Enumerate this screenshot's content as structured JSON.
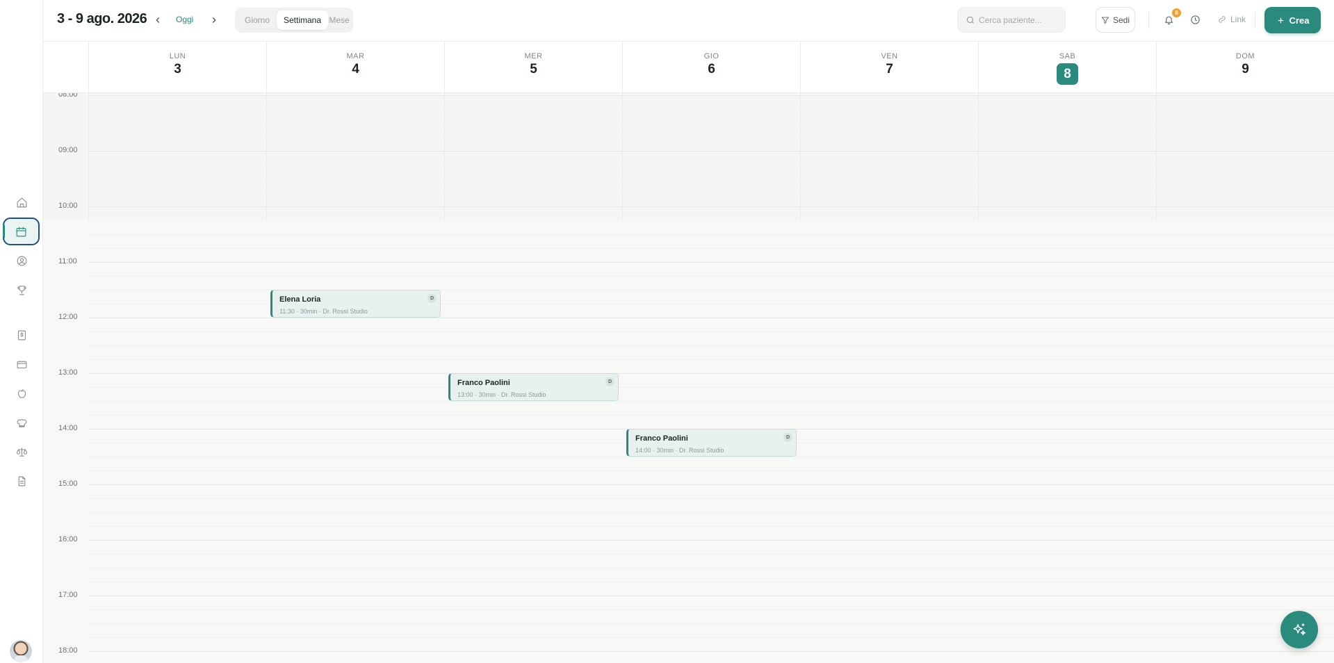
{
  "header": {
    "range_title": "3 - 9 ago. 2026",
    "today_label": "Oggi",
    "views": [
      {
        "label": "Giorno",
        "active": false
      },
      {
        "label": "Settimana",
        "active": true
      },
      {
        "label": "Mese",
        "active": false
      }
    ],
    "search_placeholder": "Cerca paziente...",
    "filter_label": "Sedi",
    "notification_count": "8",
    "link_label": "Link",
    "create_label": "Crea"
  },
  "sidebar": {
    "items": [
      {
        "name": "home-icon",
        "active": false
      },
      {
        "name": "calendar-icon",
        "active": true
      },
      {
        "name": "user-circle-icon",
        "active": false
      },
      {
        "name": "trophy-icon",
        "active": false
      },
      {
        "name": "dollar-document-icon",
        "active": false
      },
      {
        "name": "credit-card-icon",
        "active": false
      },
      {
        "name": "apple-icon",
        "active": false
      },
      {
        "name": "chef-hat-icon",
        "active": false
      },
      {
        "name": "scale-icon",
        "active": false
      },
      {
        "name": "document-icon",
        "active": false
      }
    ]
  },
  "days": [
    {
      "name": "LUN",
      "num": "3",
      "today": false
    },
    {
      "name": "MAR",
      "num": "4",
      "today": false
    },
    {
      "name": "MER",
      "num": "5",
      "today": false
    },
    {
      "name": "GIO",
      "num": "6",
      "today": false
    },
    {
      "name": "VEN",
      "num": "7",
      "today": false
    },
    {
      "name": "SAB",
      "num": "8",
      "today": true
    },
    {
      "name": "DOM",
      "num": "9",
      "today": false
    }
  ],
  "hours": [
    "08:00",
    "09:00",
    "10:00",
    "11:00",
    "12:00",
    "13:00",
    "14:00",
    "15:00",
    "16:00",
    "17:00",
    "18:00"
  ],
  "events": [
    {
      "day": 1,
      "start": "11:30",
      "title": "Elena Loria",
      "subtitle": "11:30 · 30min · Dr. Rossi Studio",
      "tag": "D"
    },
    {
      "day": 2,
      "start": "13:00",
      "title": "Franco Paolini",
      "subtitle": "13:00 · 30min · Dr. Rossi Studio",
      "tag": "D"
    },
    {
      "day": 3,
      "start": "14:00",
      "title": "Franco Paolini",
      "subtitle": "14:00 · 30min · Dr. Rossi Studio",
      "tag": "D"
    }
  ],
  "colors": {
    "accent": "#2a8a7d",
    "badge": "#f0a033"
  }
}
